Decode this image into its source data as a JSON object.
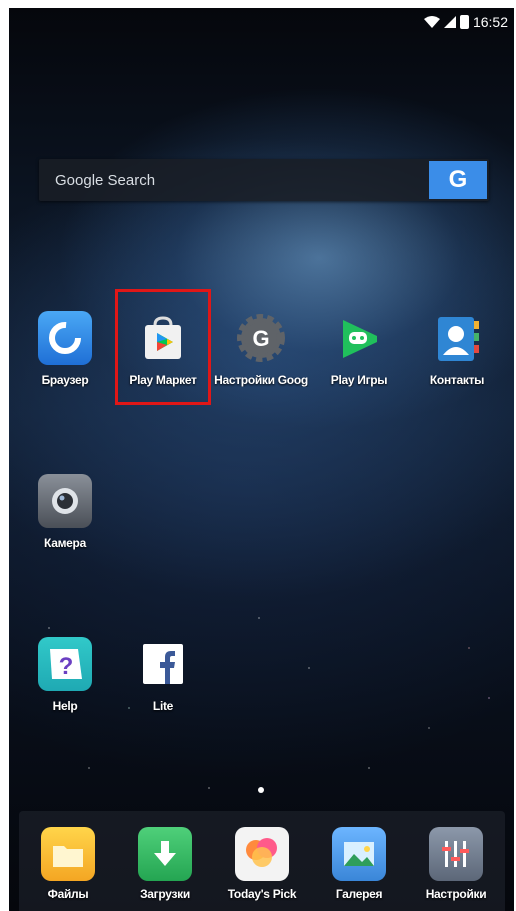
{
  "status_bar": {
    "time": "16:52",
    "icons": [
      "wifi-icon",
      "signal-icon",
      "battery-icon"
    ]
  },
  "search": {
    "label": "Google Search",
    "button": "G"
  },
  "apps": [
    {
      "label": "Браузер",
      "icon": "browser-icon"
    },
    {
      "label": "Play Маркет",
      "icon": "play-store-icon",
      "highlighted": true
    },
    {
      "label": "Настройки Goog",
      "icon": "google-settings-icon"
    },
    {
      "label": "Play Игры",
      "icon": "play-games-icon"
    },
    {
      "label": "Контакты",
      "icon": "contacts-icon"
    },
    {
      "label": "Камера",
      "icon": "camera-icon"
    },
    {
      "label": "Help",
      "icon": "help-icon"
    },
    {
      "label": "Lite",
      "icon": "facebook-lite-icon"
    }
  ],
  "dock": [
    {
      "label": "Файлы",
      "icon": "files-icon"
    },
    {
      "label": "Загрузки",
      "icon": "downloads-icon"
    },
    {
      "label": "Today's Pick",
      "icon": "todays-pick-icon"
    },
    {
      "label": "Галерея",
      "icon": "gallery-icon"
    },
    {
      "label": "Настройки",
      "icon": "settings-icon"
    }
  ],
  "colors": {
    "highlight": "#e01717",
    "search_button": "#3b8de8"
  }
}
